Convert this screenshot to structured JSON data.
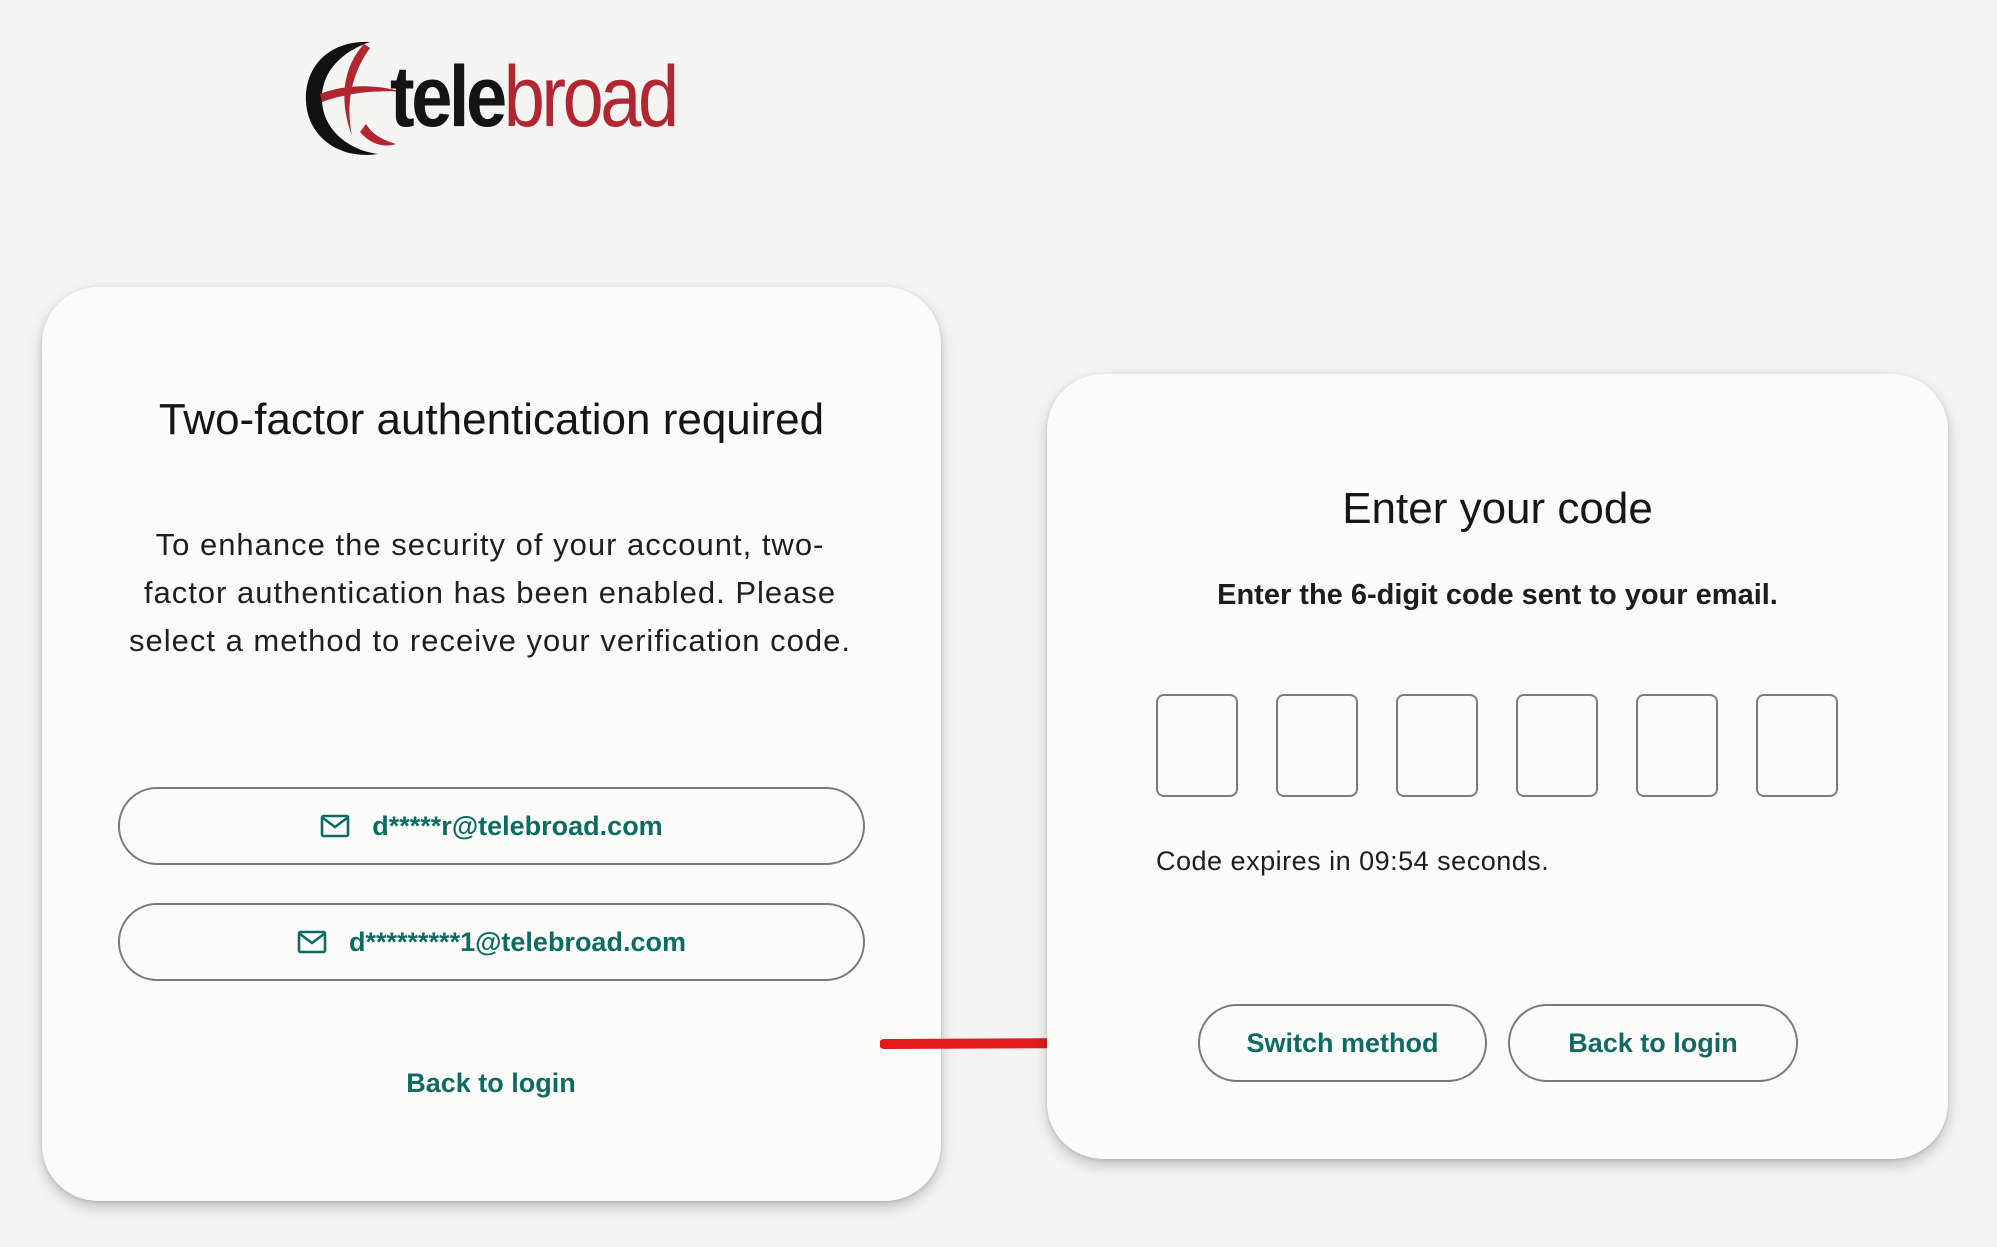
{
  "brand": {
    "logo_text_dark": "tele",
    "logo_text_red": "broad",
    "colors": {
      "dark": "#141414",
      "red": "#b22631",
      "accent": "#0f6b62"
    }
  },
  "select_method_card": {
    "title": "Two-factor authentication required",
    "description": "To enhance the security of your account, two-factor authentication has been enabled. Please select a method to receive your verification code.",
    "methods": [
      {
        "icon": "mail-icon",
        "label": "d*****r@telebroad.com"
      },
      {
        "icon": "mail-icon",
        "label": "d*********1@telebroad.com"
      }
    ],
    "back_link": "Back to login"
  },
  "annotation": {
    "icon": "red-arrow-icon",
    "color": "#e41b1b"
  },
  "enter_code_card": {
    "title": "Enter your code",
    "subtitle": "Enter the 6-digit code sent to your email.",
    "digits": [
      "",
      "",
      "",
      "",
      "",
      ""
    ],
    "expires_text": "Code expires in 09:54 seconds.",
    "switch_label": "Switch method",
    "back_label": "Back to login"
  }
}
